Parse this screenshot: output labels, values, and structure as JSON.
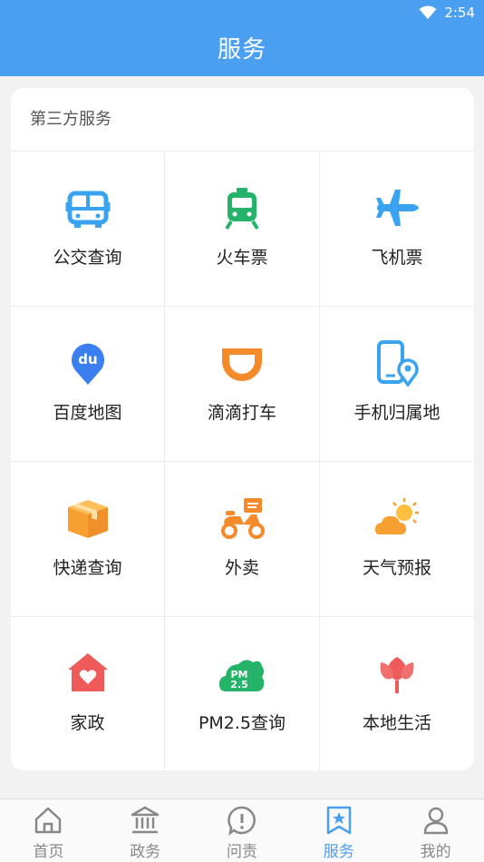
{
  "status_bar": {
    "time": "2:54"
  },
  "header": {
    "title": "服务"
  },
  "section": {
    "title": "第三方服务"
  },
  "services": [
    {
      "label": "公交查询",
      "icon": "bus-icon",
      "color": "#3aa3f0"
    },
    {
      "label": "火车票",
      "icon": "train-icon",
      "color": "#25b36a"
    },
    {
      "label": "飞机票",
      "icon": "airplane-icon",
      "color": "#3aa3f0"
    },
    {
      "label": "百度地图",
      "icon": "baidu-map-icon",
      "color": "#3a7ef0"
    },
    {
      "label": "滴滴打车",
      "icon": "didi-icon",
      "color": "#f58a2a"
    },
    {
      "label": "手机归属地",
      "icon": "phone-location-icon",
      "color": "#3aa3f0"
    },
    {
      "label": "快递查询",
      "icon": "package-icon",
      "color": "#f5a030"
    },
    {
      "label": "外卖",
      "icon": "scooter-icon",
      "color": "#f58a2a"
    },
    {
      "label": "天气预报",
      "icon": "weather-icon",
      "color": "#f5a030"
    },
    {
      "label": "家政",
      "icon": "house-icon",
      "color": "#ef5a5a"
    },
    {
      "label": "PM2.5查询",
      "icon": "pm25-icon",
      "color": "#25b36a"
    },
    {
      "label": "本地生活",
      "icon": "tulip-icon",
      "color": "#ef5a5a"
    }
  ],
  "tabs": [
    {
      "label": "首页",
      "icon": "home-icon",
      "active": false
    },
    {
      "label": "政务",
      "icon": "government-icon",
      "active": false
    },
    {
      "label": "问责",
      "icon": "alert-icon",
      "active": false
    },
    {
      "label": "服务",
      "icon": "star-bookmark-icon",
      "active": true
    },
    {
      "label": "我的",
      "icon": "user-icon",
      "active": false
    }
  ],
  "colors": {
    "primary": "#4a9ff0",
    "tab_inactive": "#888888"
  }
}
